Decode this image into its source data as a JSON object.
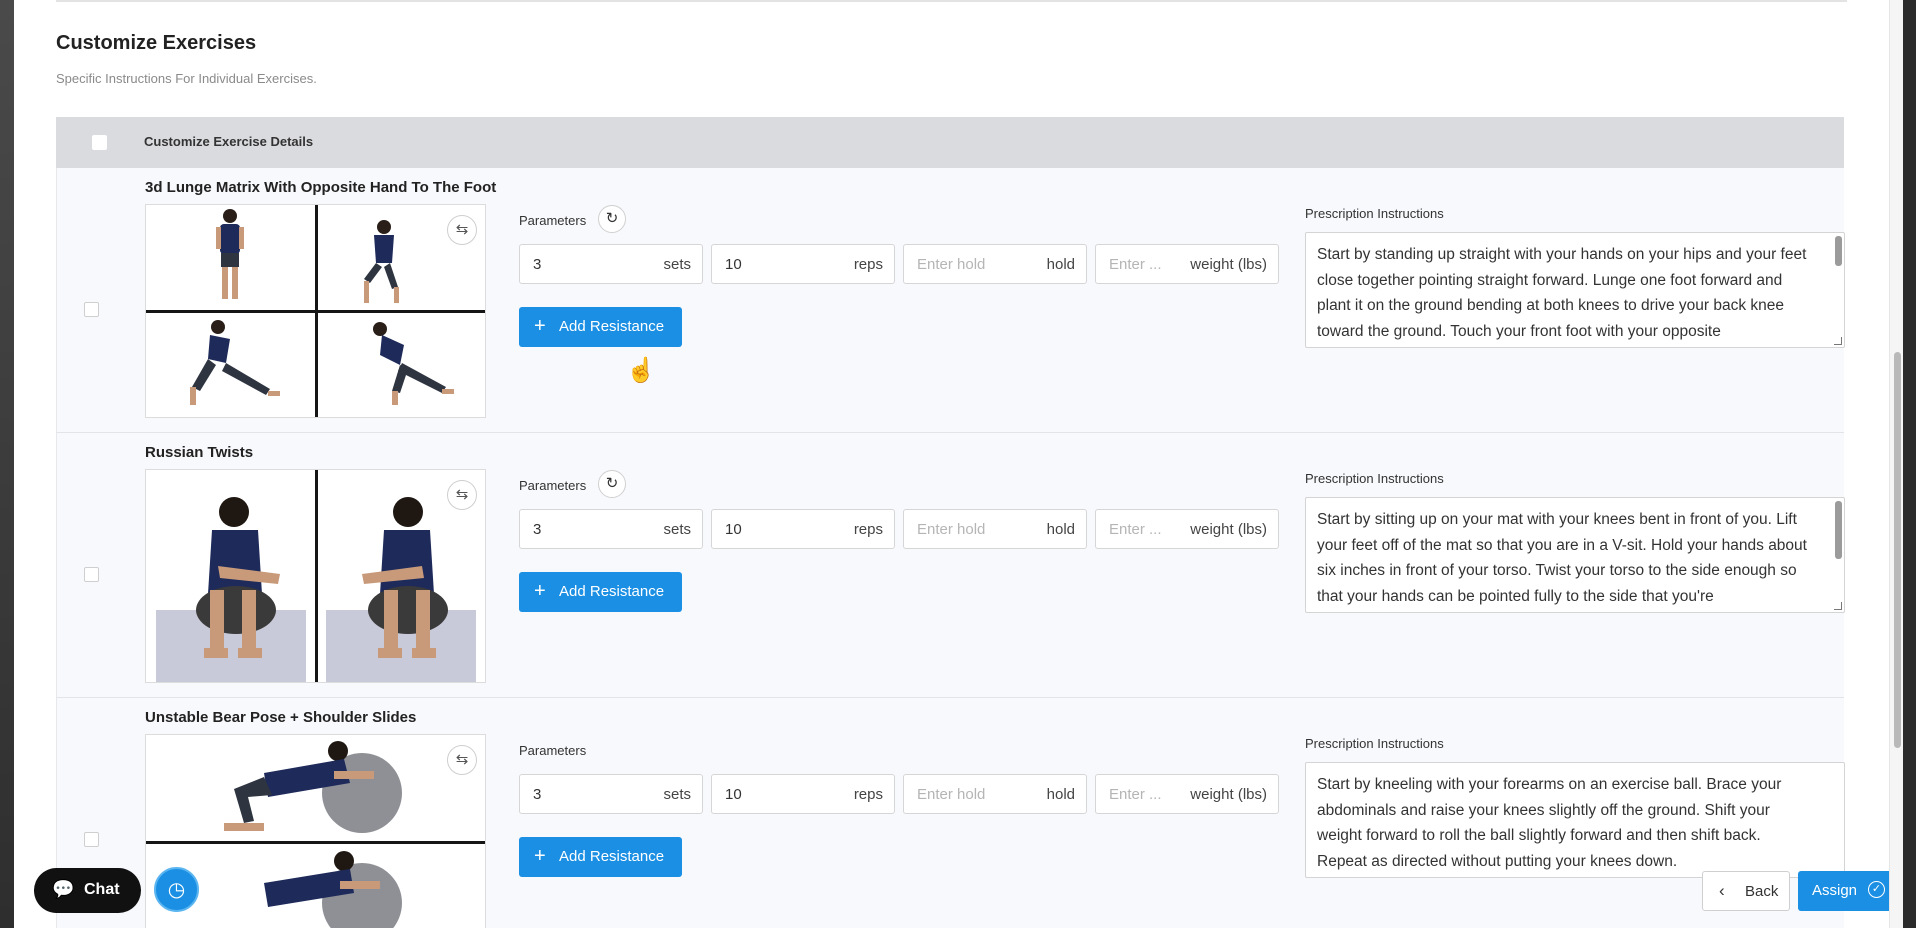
{
  "section": {
    "title": "Customize Exercises",
    "subtitle": "Specific Instructions For Individual Exercises."
  },
  "table": {
    "header_label": "Customize Exercise Details"
  },
  "labels": {
    "parameters": "Parameters",
    "prescription": "Prescription Instructions",
    "add_resistance": "Add Resistance",
    "sets_unit": "sets",
    "reps_unit": "reps",
    "hold_unit": "hold",
    "weight_unit": "weight (lbs)",
    "hold_placeholder": "Enter hold",
    "weight_placeholder": "Enter ..."
  },
  "exercises": [
    {
      "title": "3d Lunge Matrix With Opposite Hand To The Foot",
      "sets": "3",
      "reps": "10",
      "instructions": "Start by standing up straight with your hands on your hips and your feet close together pointing straight forward. Lunge one foot forward and plant it on the ground bending at both knees to drive your back knee toward the ground. Touch your front foot with your opposite"
    },
    {
      "title": "Russian Twists",
      "sets": "3",
      "reps": "10",
      "instructions": "Start by sitting up on your mat with your knees bent in front of you. Lift your feet off of the mat so that you are in a V-sit. Hold your hands about six inches in front of your torso. Twist your torso to the side enough so that your hands can be pointed fully to the side that you're"
    },
    {
      "title": "Unstable Bear Pose + Shoulder Slides",
      "sets": "3",
      "reps": "10",
      "instructions": "Start by kneeling with your forearms on an exercise ball. Brace your abdominals and raise your knees slightly off the ground. Shift your weight forward to roll the ball slightly forward and then shift back. Repeat as directed without putting your knees down."
    }
  ],
  "footer": {
    "chat_label": "Chat",
    "back_label": "Back",
    "assign_label": "Assign"
  },
  "colors": {
    "primary": "#1a8fe3",
    "header_bg": "#dadbde",
    "row_bg": "#f8f9fc"
  },
  "icons": {
    "swap": "swap-icon",
    "reset": "reset-icon",
    "plus": "plus-icon",
    "chat": "chat-bubble-icon",
    "history": "history-icon",
    "back": "chevron-left-icon",
    "assign": "check-circle-icon",
    "cursor": "hand-pointer-icon"
  }
}
